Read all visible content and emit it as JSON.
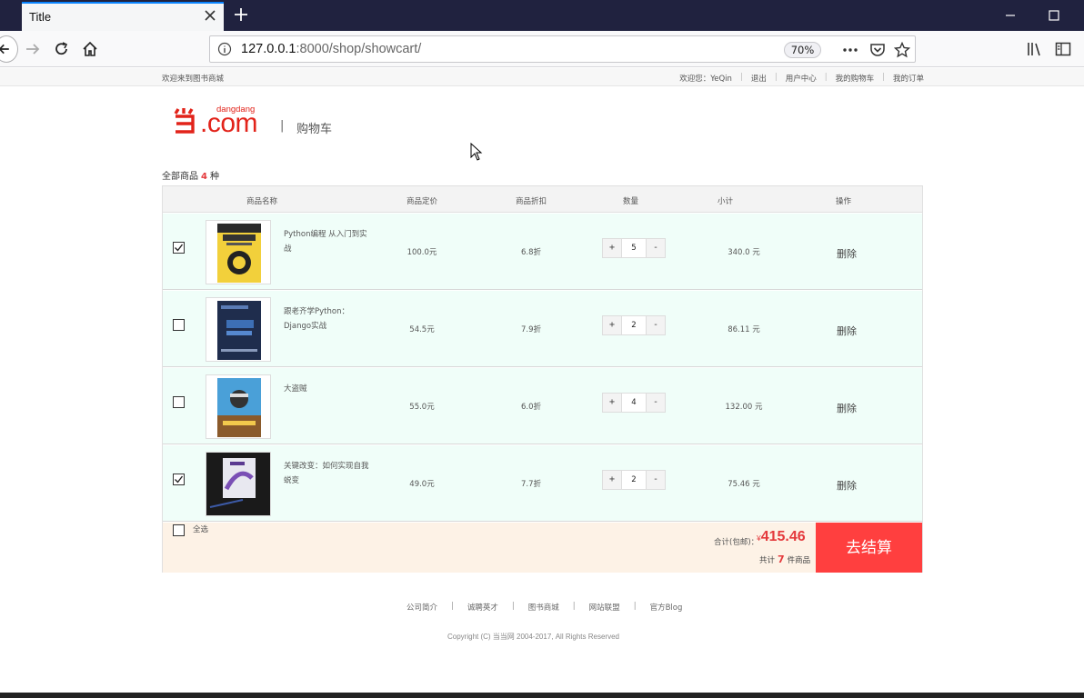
{
  "browser": {
    "tab_title": "Title",
    "url_host": "127.0.0.1",
    "url_path": ":8000/shop/showcart/",
    "zoom": "70%"
  },
  "topbar": {
    "welcome": "欢迎来到图书商城",
    "greeting": "欢迎您：YeQin",
    "links": [
      "退出",
      "用户中心",
      "我的购物车",
      "我的订单"
    ]
  },
  "header": {
    "logo_top": "dangdang",
    "logo_main": "当当.com",
    "divider": "|",
    "title": "购物车"
  },
  "summary": {
    "prefix": "全部商品",
    "count": "4",
    "suffix": "种"
  },
  "table": {
    "headers": [
      "商品名称",
      "商品定价",
      "商品折扣",
      "数量",
      "小计",
      "操作"
    ],
    "rows": [
      {
        "checked": true,
        "name": "Python编程 从入门到实战",
        "price": "100.0元",
        "discount": "6.8折",
        "qty": "5",
        "subtotal": "340.0 元",
        "action": "删除",
        "plus": "+",
        "minus": "-"
      },
      {
        "checked": false,
        "name": "跟老齐学Python：Django实战",
        "price": "54.5元",
        "discount": "7.9折",
        "qty": "2",
        "subtotal": "86.11 元",
        "action": "删除",
        "plus": "+",
        "minus": "-"
      },
      {
        "checked": false,
        "name": "大盗贼",
        "price": "55.0元",
        "discount": "6.0折",
        "qty": "4",
        "subtotal": "132.00 元",
        "action": "删除",
        "plus": "+",
        "minus": "-"
      },
      {
        "checked": true,
        "name": "关键改变：如何实现自我蜕变",
        "price": "49.0元",
        "discount": "7.7折",
        "qty": "2",
        "subtotal": "75.46 元",
        "action": "删除",
        "plus": "+",
        "minus": "-"
      }
    ]
  },
  "footer_bar": {
    "select_all": "全选",
    "total_label": "合计(包邮)：",
    "currency": "¥",
    "total": "415.46",
    "count_prefix": "共计",
    "count": "7",
    "count_suffix": "件商品",
    "checkout": "去结算"
  },
  "site_footer": {
    "links": [
      "公司简介",
      "诚聘英才",
      "图书商城",
      "网站联盟",
      "官方Blog"
    ],
    "copyright": "Copyright (C) 当当网 2004-2017, All Rights Reserved"
  },
  "colors": {
    "brand_red": "#e2231a",
    "price_red": "#e4393c",
    "checkout_bg": "#ff3f3f",
    "row_bg": "#f0fef9",
    "footer_bg": "#fdf2e6"
  }
}
